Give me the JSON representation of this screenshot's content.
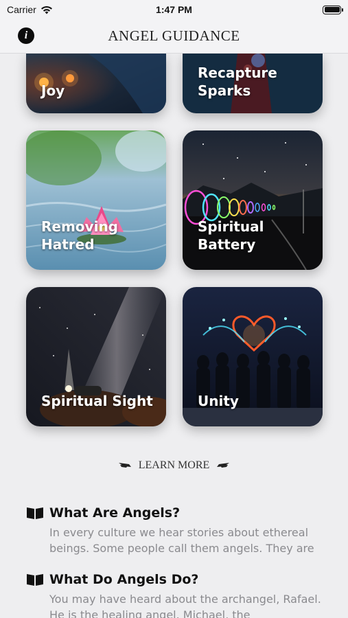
{
  "status": {
    "carrier": "Carrier",
    "time": "1:47 PM"
  },
  "nav": {
    "title": "ANGEL GUIDANCE",
    "info_icon": "info-icon"
  },
  "tiles": [
    {
      "label": "Joy"
    },
    {
      "label": "Recapture\nSparks"
    },
    {
      "label": "Removing\nHatred"
    },
    {
      "label": "Spiritual\nBattery"
    },
    {
      "label": "Spiritual Sight"
    },
    {
      "label": "Unity"
    }
  ],
  "learn_more": {
    "label": "LEARN MORE"
  },
  "faq": [
    {
      "title": "What Are Angels?",
      "body": "In every culture we hear stories about ethereal beings. Some people call them angels. They are",
      "icon": "book-icon"
    },
    {
      "title": "What Do Angels Do?",
      "body": "You may have heard about the archangel, Rafael. He is the healing angel. Michael, the",
      "icon": "book-icon"
    }
  ]
}
